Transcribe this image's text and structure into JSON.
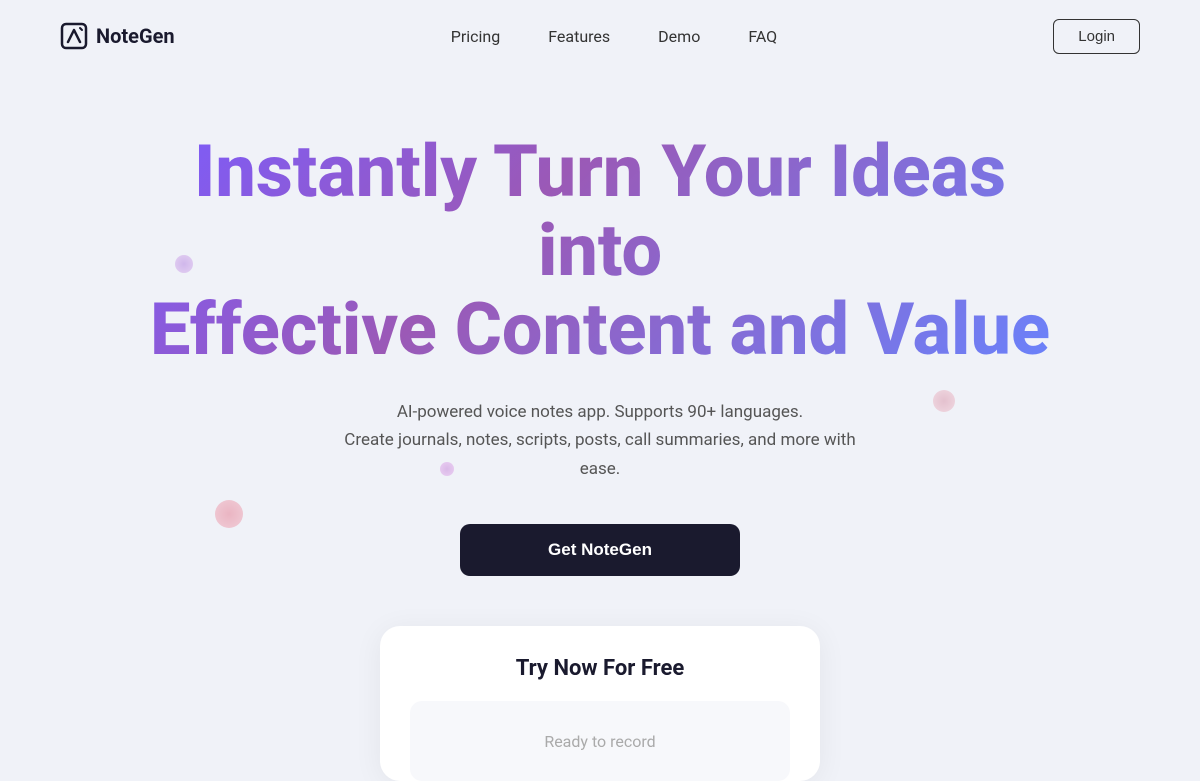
{
  "brand": {
    "logo_text": "NoteGen"
  },
  "nav": {
    "links": [
      {
        "label": "Pricing",
        "id": "pricing"
      },
      {
        "label": "Features",
        "id": "features"
      },
      {
        "label": "Demo",
        "id": "demo"
      },
      {
        "label": "FAQ",
        "id": "faq"
      }
    ],
    "login_label": "Login"
  },
  "hero": {
    "title_line1": "Instantly Turn Your Ideas into",
    "title_line2": "Effective Content and Value",
    "subtitle_line1": "AI-powered voice notes app. Supports 90+ languages.",
    "subtitle_line2": "Create journals, notes, scripts, posts, call summaries, and more with ease.",
    "cta_label": "Get NoteGen"
  },
  "try_card": {
    "title": "Try Now For Free",
    "record_placeholder": "Ready to record"
  }
}
